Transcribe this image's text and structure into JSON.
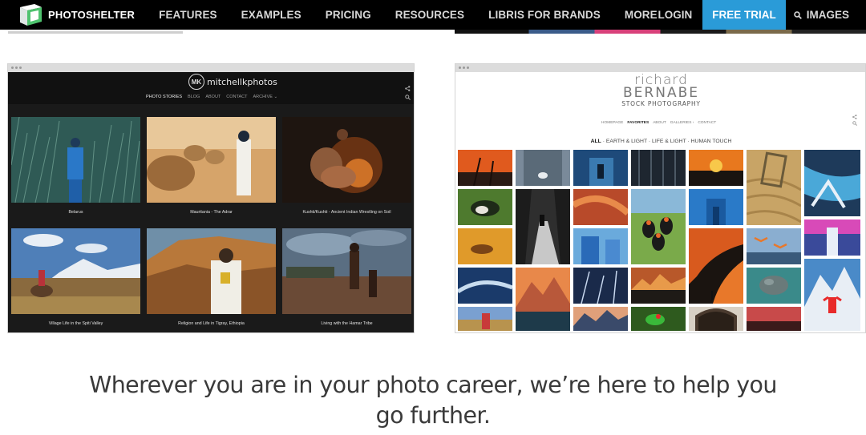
{
  "nav": {
    "brand": "PHOTOSHELTER",
    "links": [
      "FEATURES",
      "EXAMPLES",
      "PRICING",
      "RESOURCES",
      "LIBRIS FOR BRANDS",
      "MORE"
    ],
    "login": "LOGIN",
    "trial": "FREE TRIAL",
    "images": "IMAGES",
    "accent": "#2a9bd8"
  },
  "site1": {
    "name": "mitchellkphotos",
    "logo_initials": "MK",
    "menu": [
      "PHOTO STORIES",
      "BLOG",
      "ABOUT",
      "CONTACT",
      "ARCHIVE ⌄"
    ],
    "tiles": [
      {
        "caption": "Belarus"
      },
      {
        "caption": "Mauritania - The Adrar"
      },
      {
        "caption": "Kushti/Kushti - Ancient Indian Wrestling on Soil"
      },
      {
        "caption": "Village Life in the Spiti Valley"
      },
      {
        "caption": "Religion and Life in Tigray, Ethiopia"
      },
      {
        "caption": "Living with the Hamar Tribe"
      }
    ]
  },
  "site2": {
    "logo_line1": "richard",
    "logo_line2": "BERNABE",
    "logo_line3": "STOCK PHOTOGRAPHY",
    "menu": [
      "HOMEPAGE",
      "FAVORITES",
      "ABOUT",
      "GALLERIES ›",
      "CONTACT"
    ],
    "filter_all": "ALL",
    "filter_rest": " · EARTH & LIGHT · LIFE & LIGHT · HUMAN TOUCH"
  },
  "headline": {
    "line1": "Wherever you are in your photo career, we’re here to help you",
    "line2": "go further."
  }
}
